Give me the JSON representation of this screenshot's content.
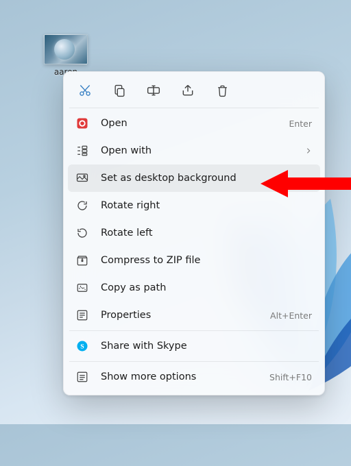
{
  "desktopIcon": {
    "caption": "aaron"
  },
  "quickActions": [
    {
      "name": "cut-icon"
    },
    {
      "name": "copy-icon"
    },
    {
      "name": "rename-icon"
    },
    {
      "name": "share-icon"
    },
    {
      "name": "delete-icon"
    }
  ],
  "menu": {
    "open": {
      "label": "Open",
      "hint": "Enter"
    },
    "openWith": {
      "label": "Open with"
    },
    "setBg": {
      "label": "Set as desktop background"
    },
    "rotateRight": {
      "label": "Rotate right"
    },
    "rotateLeft": {
      "label": "Rotate left"
    },
    "compress": {
      "label": "Compress to ZIP file"
    },
    "copyPath": {
      "label": "Copy as path"
    },
    "properties": {
      "label": "Properties",
      "hint": "Alt+Enter"
    },
    "shareSkype": {
      "label": "Share with Skype"
    },
    "moreOptions": {
      "label": "Show more options",
      "hint": "Shift+F10"
    }
  },
  "arrow": {
    "color": "#ff0000"
  }
}
